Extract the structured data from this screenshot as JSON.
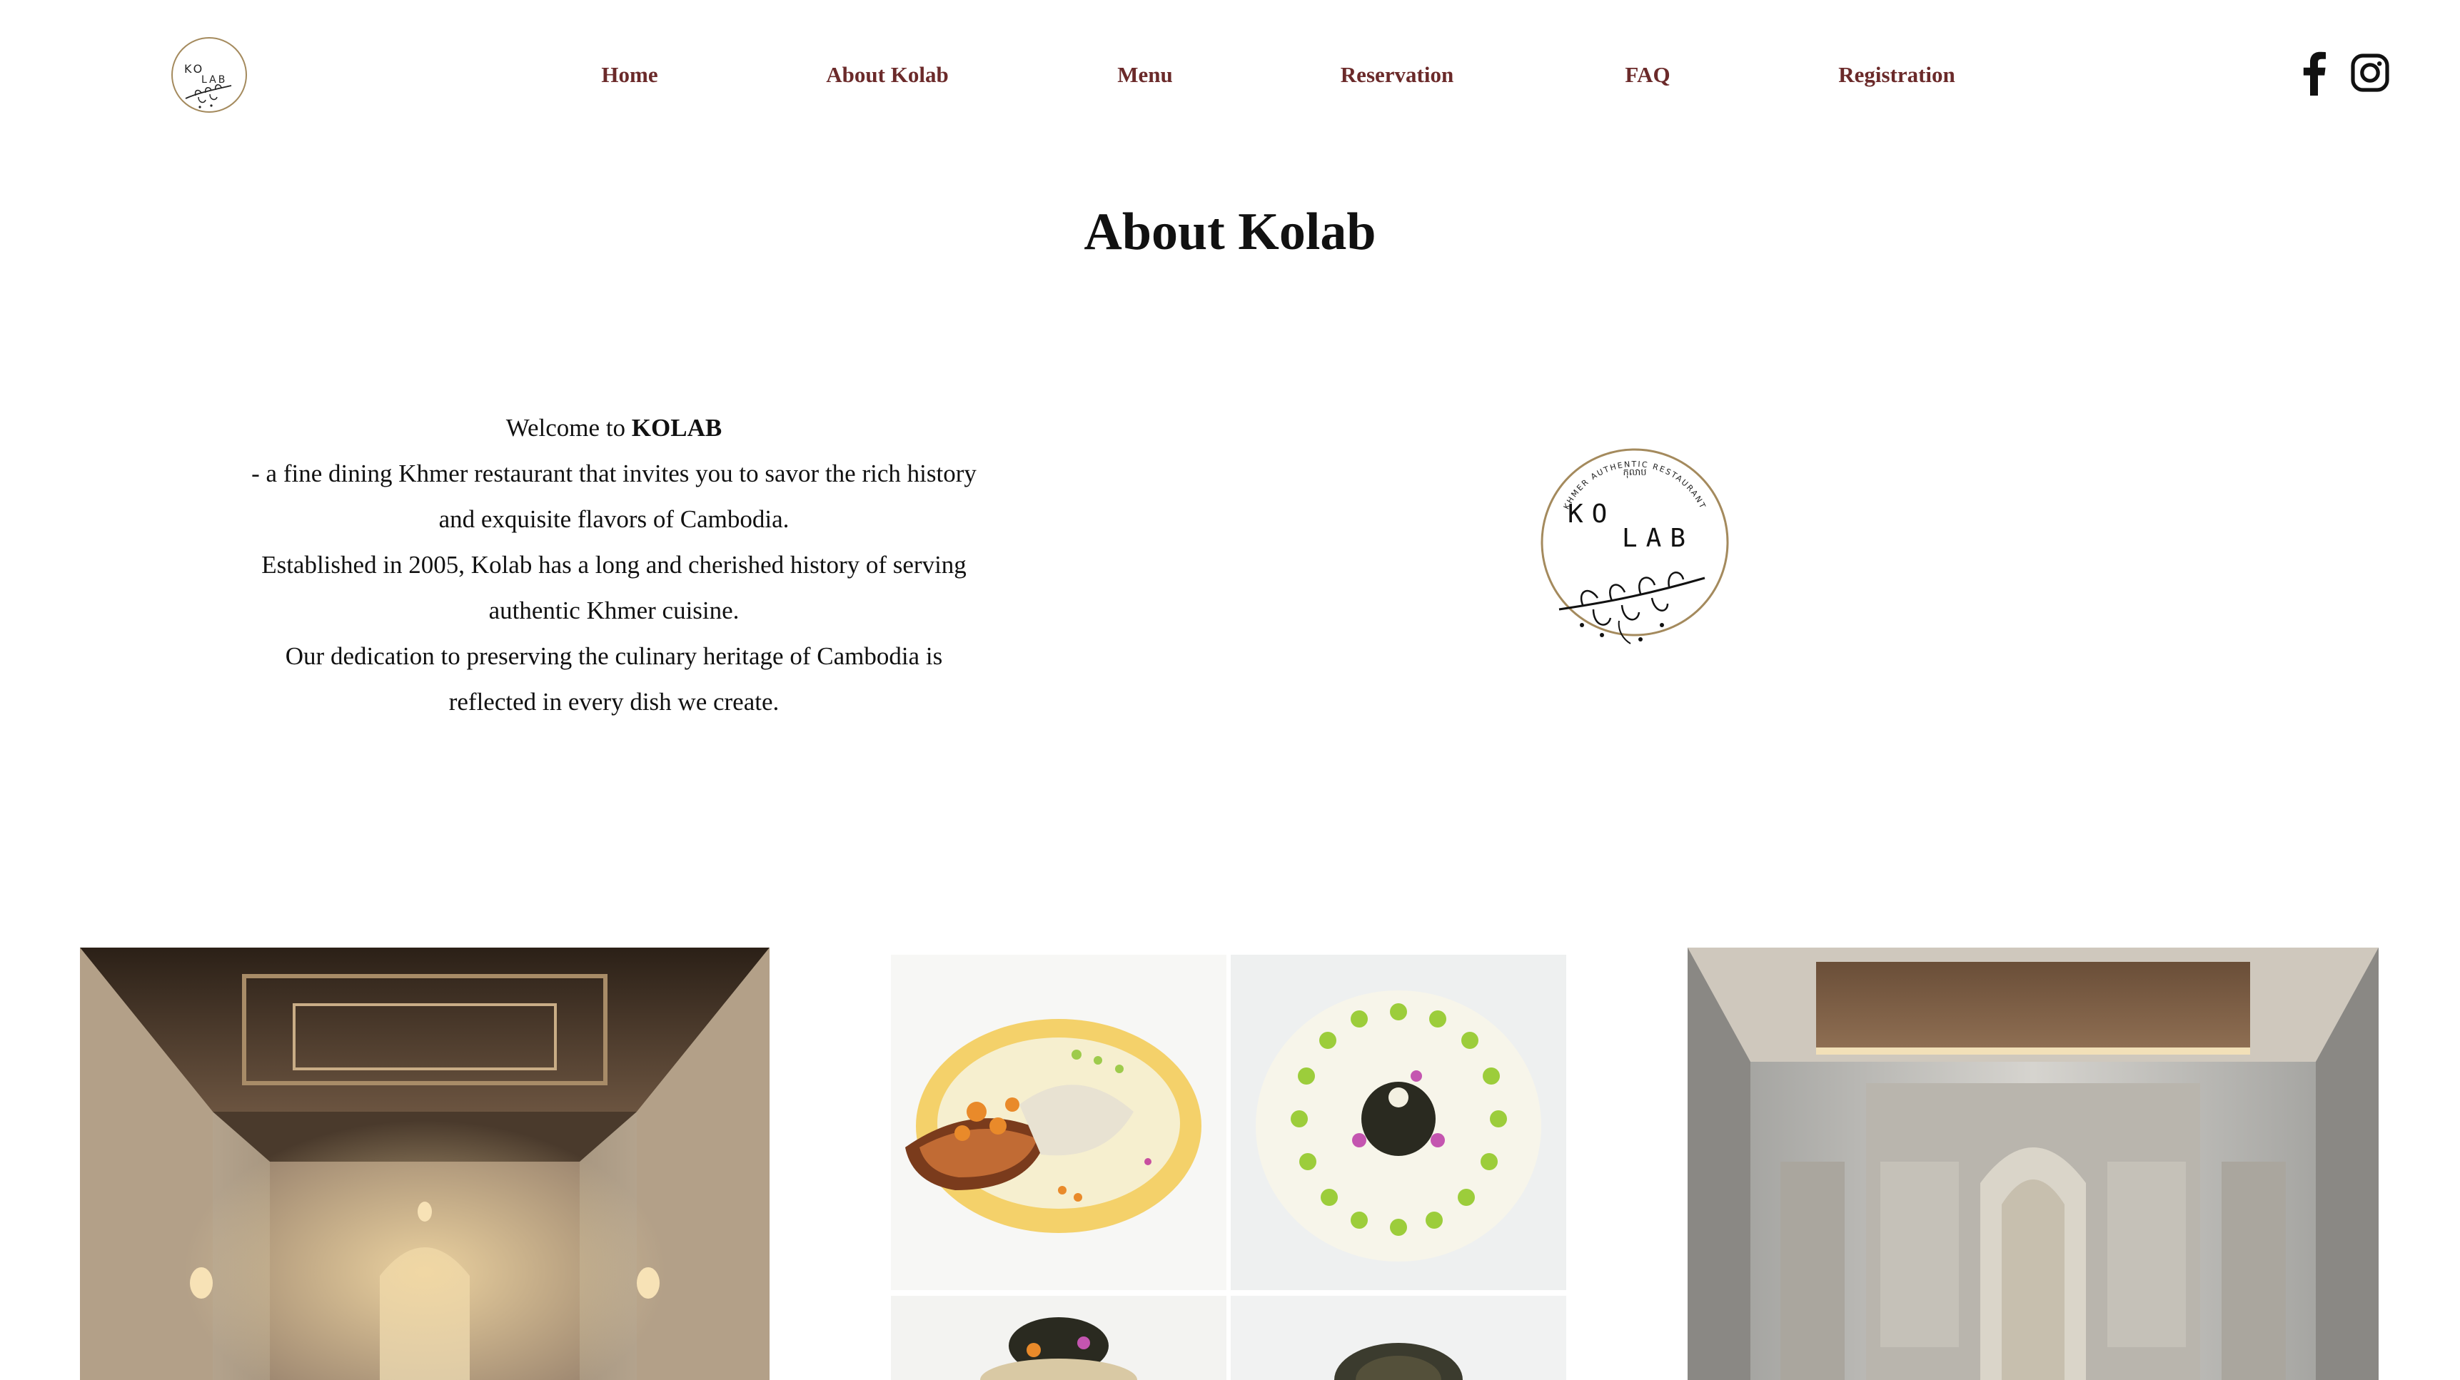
{
  "header": {
    "logo": {
      "text_top": "KO",
      "text_bottom": "LAB",
      "icon": "kolab-logo-icon"
    },
    "nav": [
      {
        "label": "Home"
      },
      {
        "label": "About Kolab"
      },
      {
        "label": "Menu"
      },
      {
        "label": "Reservation"
      },
      {
        "label": "FAQ"
      },
      {
        "label": "Registration"
      }
    ],
    "social": [
      {
        "icon": "facebook-icon"
      },
      {
        "icon": "instagram-icon"
      }
    ]
  },
  "main": {
    "title": "About Kolab",
    "intro": {
      "welcome_prefix": "Welcome to ",
      "welcome_brand": "KOLAB",
      "line1": "- a fine dining Khmer restaurant that invites you to savor the rich history and exquisite flavors of Cambodia.",
      "line2": "Established in 2005, Kolab has a long and cherished history of serving authentic Khmer cuisine.",
      "line3": "Our dedication to preserving the culinary heritage of Cambodia is reflected in every dish we create."
    },
    "emblem": {
      "arc_text": "KHMER AUTHENTIC RESTAURANT",
      "khmer_text": "កុលាប",
      "text_top": "KO",
      "text_bottom": "LAB"
    }
  },
  "gallery": [
    {
      "name": "dining-hall-image"
    },
    {
      "name": "dishes-collage-image"
    },
    {
      "name": "banquet-hall-image"
    }
  ],
  "colors": {
    "nav_text": "#6b2a2a",
    "body_text": "#111111",
    "logo_ring": "#a48a5d",
    "background": "#ffffff"
  }
}
